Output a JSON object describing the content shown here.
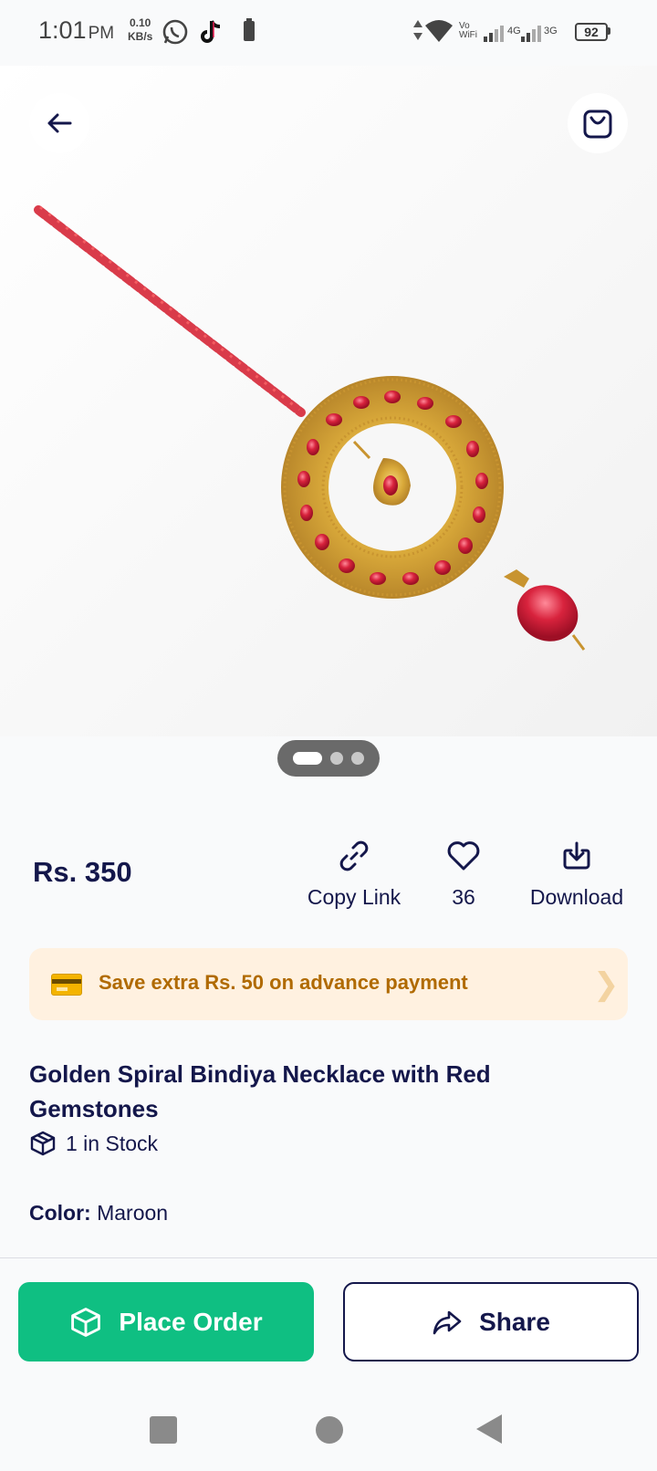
{
  "status_bar": {
    "time": "1:01",
    "ampm": "PM",
    "speed_value": "0.10",
    "speed_unit": "KB/s",
    "network_4g": "4G",
    "network_3g": "3G",
    "vowifi_top": "Vo",
    "vowifi_bottom": "WiFi",
    "battery": "92"
  },
  "product": {
    "price": "Rs. 350",
    "title": "Golden Spiral Bindiya Necklace with Red Gemstones",
    "stock": "1 in Stock",
    "color_label": "Color:",
    "color_value": "Maroon",
    "image_count": 3,
    "active_image": 1
  },
  "actions": {
    "copy_link": "Copy Link",
    "likes": "36",
    "download": "Download"
  },
  "promo": {
    "text": "Save extra Rs. 50 on advance payment"
  },
  "buttons": {
    "place_order": "Place Order",
    "share": "Share"
  },
  "colors": {
    "primary_navy": "#14174b",
    "accent_green": "#0fbf82",
    "promo_bg": "#fff1e0",
    "promo_text": "#b06a00"
  }
}
